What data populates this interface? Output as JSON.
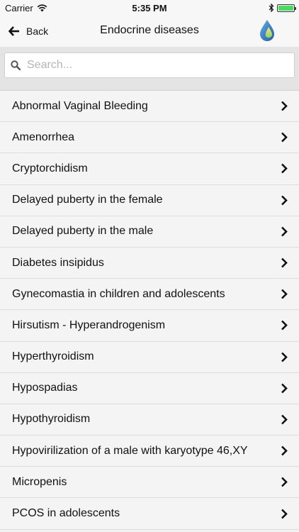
{
  "status": {
    "carrier": "Carrier",
    "time": "5:35 PM"
  },
  "nav": {
    "back_label": "Back",
    "title": "Endocrine diseases"
  },
  "search": {
    "placeholder": "Search..."
  },
  "colors": {
    "battery": "#4cd964",
    "chevron": "#111111"
  },
  "items": [
    {
      "label": "Abnormal Vaginal Bleeding"
    },
    {
      "label": "Amenorrhea"
    },
    {
      "label": "Cryptorchidism"
    },
    {
      "label": "Delayed puberty in the female"
    },
    {
      "label": "Delayed puberty in the male"
    },
    {
      "label": "Diabetes insipidus"
    },
    {
      "label": "Gynecomastia in children and adolescents"
    },
    {
      "label": "Hirsutism - Hyperandrogenism"
    },
    {
      "label": "Hyperthyroidism"
    },
    {
      "label": "Hypospadias"
    },
    {
      "label": "Hypothyroidism"
    },
    {
      "label": "Hypovirilization of a male with karyotype 46,XY"
    },
    {
      "label": "Micropenis"
    },
    {
      "label": "PCOS in adolescents"
    }
  ]
}
